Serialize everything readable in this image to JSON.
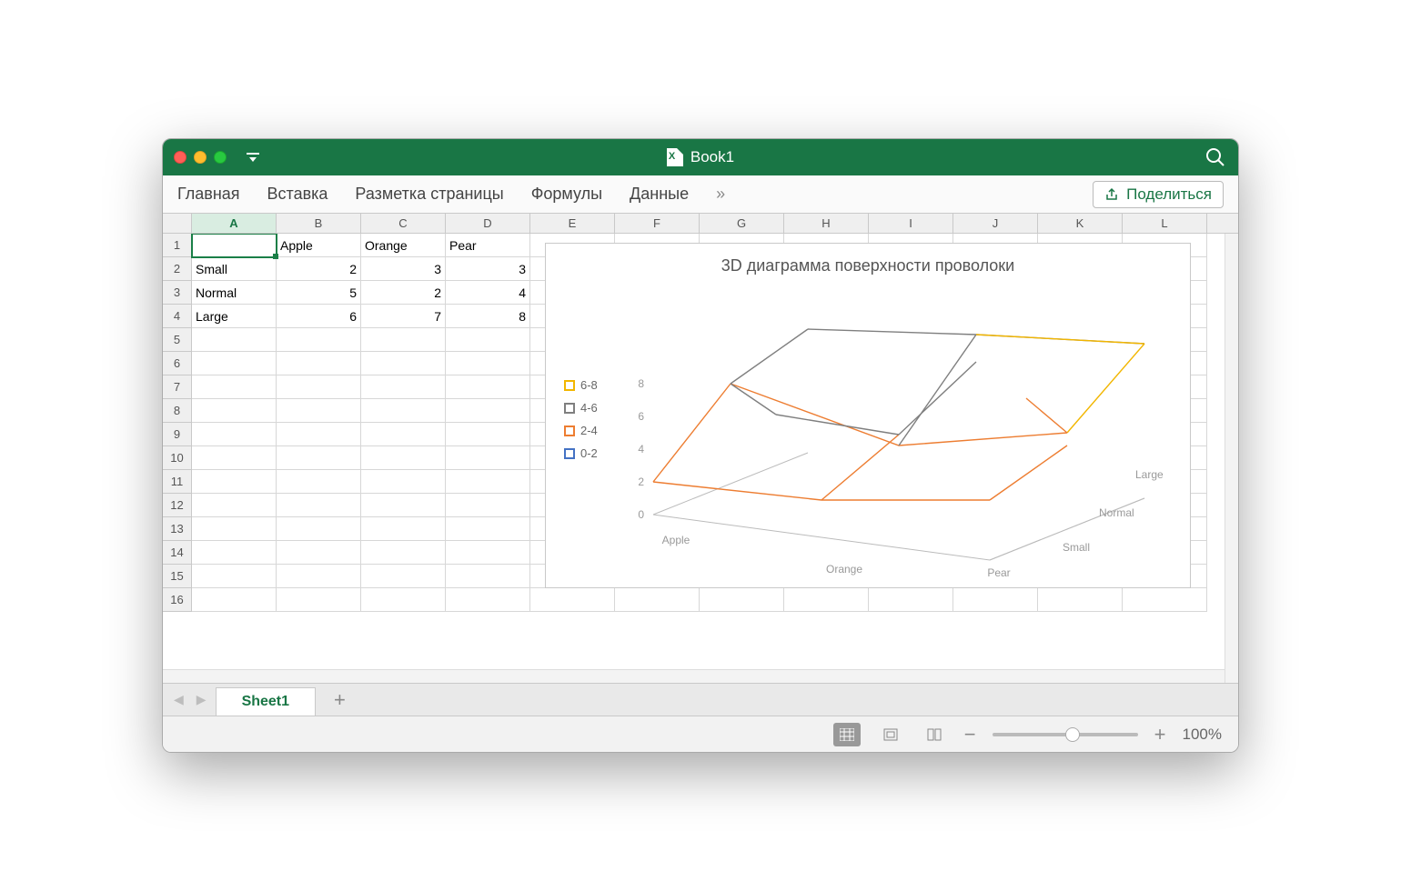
{
  "window": {
    "title": "Book1"
  },
  "ribbon": {
    "tabs": [
      "Главная",
      "Вставка",
      "Разметка страницы",
      "Формулы",
      "Данные"
    ],
    "more": "»",
    "share": "Поделиться"
  },
  "columns": [
    "A",
    "B",
    "C",
    "D",
    "E",
    "F",
    "G",
    "H",
    "I",
    "J",
    "K",
    "L"
  ],
  "active_col_index": 0,
  "rows": [
    1,
    2,
    3,
    4,
    5,
    6,
    7,
    8,
    9,
    10,
    11,
    12,
    13,
    14,
    15,
    16
  ],
  "cells": {
    "B1": "Apple",
    "C1": "Orange",
    "D1": "Pear",
    "A2": "Small",
    "B2": "2",
    "C2": "3",
    "D2": "3",
    "A3": "Normal",
    "B3": "5",
    "C3": "2",
    "D3": "4",
    "A4": "Large",
    "B4": "6",
    "C4": "7",
    "D4": "8"
  },
  "selected_cell": "A1",
  "chart_data": {
    "type": "surface-wireframe-3d",
    "title": "3D диаграмма поверхности проволоки",
    "x_categories": [
      "Apple",
      "Orange",
      "Pear"
    ],
    "depth_categories": [
      "Small",
      "Normal",
      "Large"
    ],
    "z_values": [
      [
        2,
        3,
        3
      ],
      [
        5,
        2,
        4
      ],
      [
        6,
        7,
        8
      ]
    ],
    "z_ticks": [
      0,
      2,
      4,
      6,
      8
    ],
    "legend": [
      {
        "label": "6-8",
        "color": "#f2b600"
      },
      {
        "label": "4-6",
        "color": "#7f7f7f"
      },
      {
        "label": "2-4",
        "color": "#ed7d31"
      },
      {
        "label": "0-2",
        "color": "#4472c4"
      }
    ]
  },
  "sheet_tab": "Sheet1",
  "zoom": "100%"
}
